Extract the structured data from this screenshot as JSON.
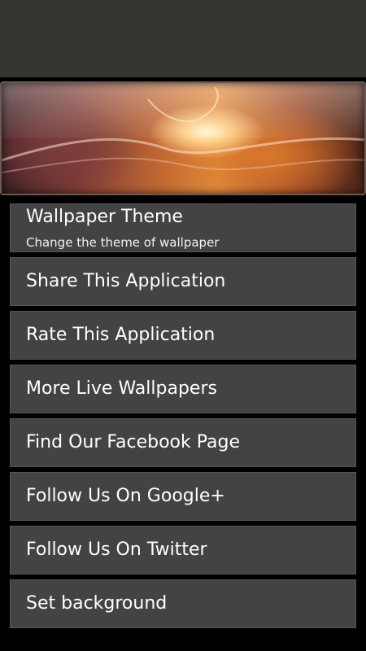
{
  "banner": {
    "image_name": "canyon-wallpaper-image"
  },
  "menu": {
    "items": [
      {
        "title": "Wallpaper Theme",
        "subtitle": "Change the theme of wallpaper"
      },
      {
        "title": "Share This Application"
      },
      {
        "title": "Rate This Application"
      },
      {
        "title": "More Live Wallpapers"
      },
      {
        "title": "Find Our Facebook Page"
      },
      {
        "title": "Follow Us On Google+"
      },
      {
        "title": "Follow Us On Twitter"
      },
      {
        "title": "Set background"
      }
    ]
  },
  "colors": {
    "topbar": "#353431",
    "item_bg": "#434345",
    "page_bg": "#000000",
    "text": "#ffffff"
  }
}
